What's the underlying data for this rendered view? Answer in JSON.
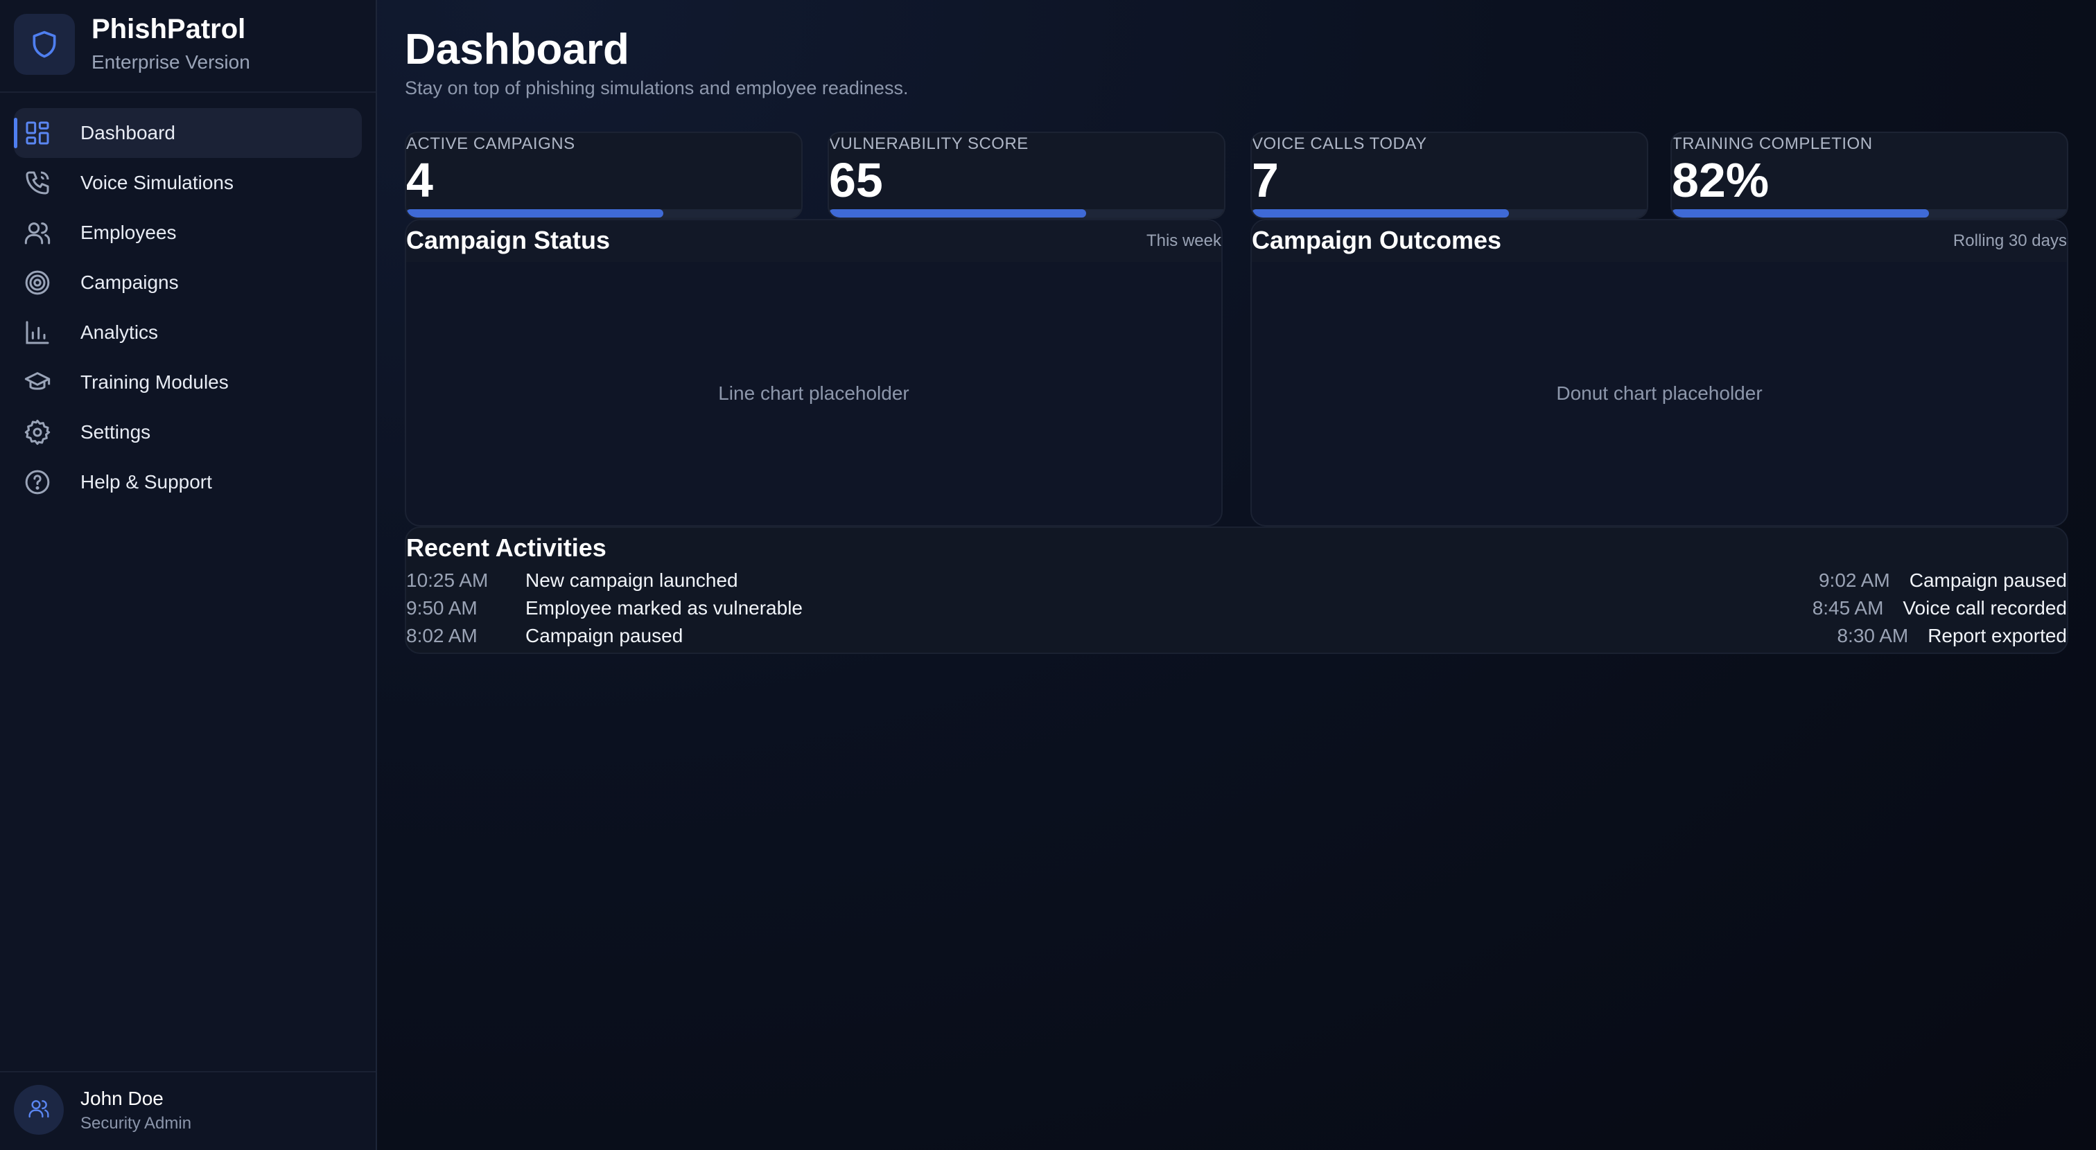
{
  "brand": {
    "name": "PhishPatrol",
    "subtitle": "Enterprise Version",
    "logo_icon": "shield-icon"
  },
  "nav": [
    {
      "label": "Dashboard",
      "icon": "grid-icon",
      "active": true
    },
    {
      "label": "Voice Simulations",
      "icon": "phone-icon"
    },
    {
      "label": "Employees",
      "icon": "users-icon"
    },
    {
      "label": "Campaigns",
      "icon": "target-icon"
    },
    {
      "label": "Analytics",
      "icon": "bar-chart-icon"
    },
    {
      "label": "Training Modules",
      "icon": "graduation-cap-icon"
    },
    {
      "label": "Settings",
      "icon": "gear-icon"
    },
    {
      "label": "Help & Support",
      "icon": "help-circle-icon"
    }
  ],
  "user": {
    "name": "John Doe",
    "role": "Security Admin",
    "avatar_icon": "users-icon"
  },
  "header": {
    "title": "Dashboard",
    "subtitle": "Stay on top of phishing simulations and employee readiness."
  },
  "stats": [
    {
      "label": "ACTIVE CAMPAIGNS",
      "value": "4",
      "progress": 0.65
    },
    {
      "label": "VULNERABILITY SCORE",
      "value": "65",
      "progress": 0.65
    },
    {
      "label": "VOICE CALLS TODAY",
      "value": "7",
      "progress": 0.65
    },
    {
      "label": "TRAINING COMPLETION",
      "value": "82%",
      "progress": 0.65
    }
  ],
  "cards": {
    "status": {
      "title": "Campaign Status",
      "meta": "This week",
      "placeholder": "Line chart placeholder"
    },
    "outcomes": {
      "title": "Campaign Outcomes",
      "meta": "Rolling 30 days",
      "placeholder": "Donut chart placeholder"
    }
  },
  "activities": {
    "title": "Recent Activities",
    "left": [
      {
        "time": "10:25 AM",
        "text": "New campaign launched"
      },
      {
        "time": "9:50 AM",
        "text": "Employee marked as vulnerable"
      },
      {
        "time": "8:02 AM",
        "text": "Campaign paused"
      }
    ],
    "right": [
      {
        "time": "9:02 AM",
        "text": "Campaign paused"
      },
      {
        "time": "8:45 AM",
        "text": "Voice call recorded"
      },
      {
        "time": "8:30 AM",
        "text": "Report exported"
      }
    ]
  },
  "colors": {
    "accent": "#4f7ff0",
    "progress": "#3f6ad6",
    "background": "#090d18",
    "sidebar": "#0e1424"
  }
}
